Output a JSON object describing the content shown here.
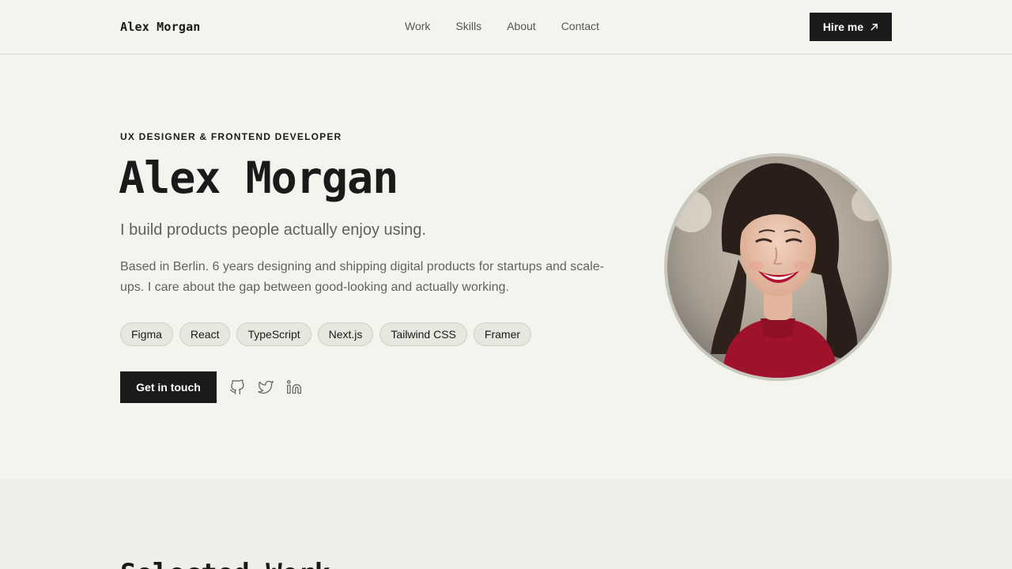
{
  "header": {
    "logo": "Alex Morgan",
    "nav": [
      "Work",
      "Skills",
      "About",
      "Contact"
    ],
    "hire_label": "Hire me"
  },
  "hero": {
    "eyebrow": "UX DESIGNER & FRONTEND DEVELOPER",
    "name": "Alex Morgan",
    "tagline": "I build products people actually enjoy using.",
    "bio": "Based in Berlin. 6 years designing and shipping digital products for startups and scale-ups. I care about the gap between good-looking and actually working.",
    "skills": [
      "Figma",
      "React",
      "TypeScript",
      "Next.js",
      "Tailwind CSS",
      "Framer"
    ],
    "cta_label": "Get in touch",
    "social_icons": [
      "github-icon",
      "twitter-icon",
      "linkedin-icon"
    ]
  },
  "next_section": {
    "title": "Selected Work"
  },
  "colors": {
    "background": "#f4f4ef",
    "accent": "#1b1b1b",
    "chip_bg": "#e7e7e0"
  }
}
